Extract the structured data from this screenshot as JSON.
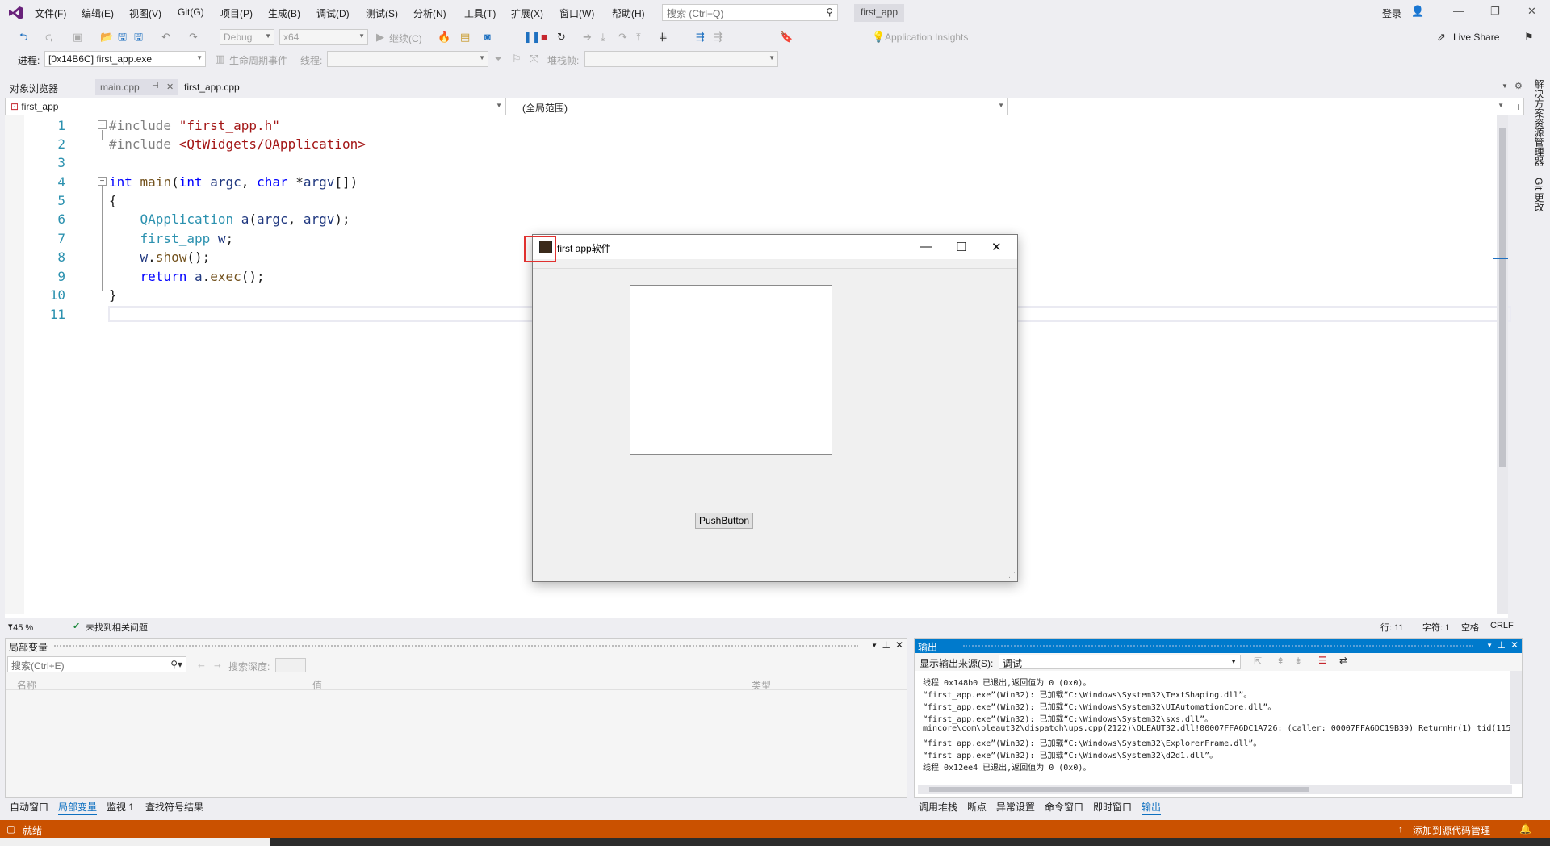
{
  "menu": {
    "items": [
      "文件(F)",
      "编辑(E)",
      "视图(V)",
      "Git(G)",
      "项目(P)",
      "生成(B)",
      "调试(D)",
      "测试(S)",
      "分析(N)",
      "工具(T)",
      "扩展(X)",
      "窗口(W)",
      "帮助(H)"
    ],
    "search_placeholder": "搜索 (Ctrl+Q)",
    "solution_title": "first_app",
    "login": "登录"
  },
  "toolbar": {
    "config": "Debug",
    "platform": "x64",
    "continue": "继续(C)",
    "insights": "Application Insights",
    "live_share": "Live Share",
    "process_label": "进程:",
    "process_value": "[0x14B6C] first_app.exe",
    "lifecycle": "生命周期事件",
    "thread_label": "线程:",
    "stack_label": "堆栈帧:"
  },
  "tabs": {
    "object_browser": "对象浏览器",
    "main_cpp": "main.cpp",
    "first_app_cpp": "first_app.cpp"
  },
  "navbar": {
    "project": "first_app",
    "scope": "(全局范围)"
  },
  "editor": {
    "lines": [
      "1",
      "2",
      "3",
      "4",
      "5",
      "6",
      "7",
      "8",
      "9",
      "10",
      "11"
    ],
    "zoom": "145 %",
    "issues": "未找到相关问题",
    "row": "行: 11",
    "col": "字符: 1",
    "spacing": "空格",
    "eol": "CRLF"
  },
  "qt_window": {
    "title": "first app软件",
    "button": "PushButton"
  },
  "right_strip": {
    "solution_explorer": "解决方案资源管理器",
    "git_changes": "Git 更改"
  },
  "locals_panel": {
    "title": "局部变量",
    "search_placeholder": "搜索(Ctrl+E)",
    "search_depth": "搜索深度:",
    "col_name": "名称",
    "col_value": "值",
    "col_type": "类型"
  },
  "output_panel": {
    "title": "输出",
    "source_label": "显示输出来源(S):",
    "source_value": "调试",
    "lines": [
      "线程 0x148b0 已退出,返回值为 0 (0x0)。",
      "“first_app.exe”(Win32): 已加载“C:\\Windows\\System32\\TextShaping.dll”。",
      "“first_app.exe”(Win32): 已加载“C:\\Windows\\System32\\UIAutomationCore.dll”。",
      "“first_app.exe”(Win32): 已加载“C:\\Windows\\System32\\sxs.dll”。",
      "mincore\\com\\oleaut32\\dispatch\\ups.cpp(2122)\\OLEAUT32.dll!00007FFA6DC1A726: (caller: 00007FFA6DC19B39) ReturnHr(1) tid(115",
      "“first_app.exe”(Win32): 已加载“C:\\Windows\\System32\\ExplorerFrame.dll”。",
      "“first_app.exe”(Win32): 已加载“C:\\Windows\\System32\\d2d1.dll”。",
      "线程 0x12ee4 已退出,返回值为 0 (0x0)。"
    ]
  },
  "bottom_tabs_left": [
    "自动窗口",
    "局部变量",
    "监视 1",
    "查找符号结果"
  ],
  "bottom_tabs_right": [
    "调用堆栈",
    "断点",
    "异常设置",
    "命令窗口",
    "即时窗口",
    "输出"
  ],
  "status": {
    "ready": "就绪",
    "source_control": "添加到源代码管理"
  },
  "colors": {
    "accent": "#007acc",
    "status_bar": "#ca5100",
    "highlight_box": "#e0312f"
  }
}
